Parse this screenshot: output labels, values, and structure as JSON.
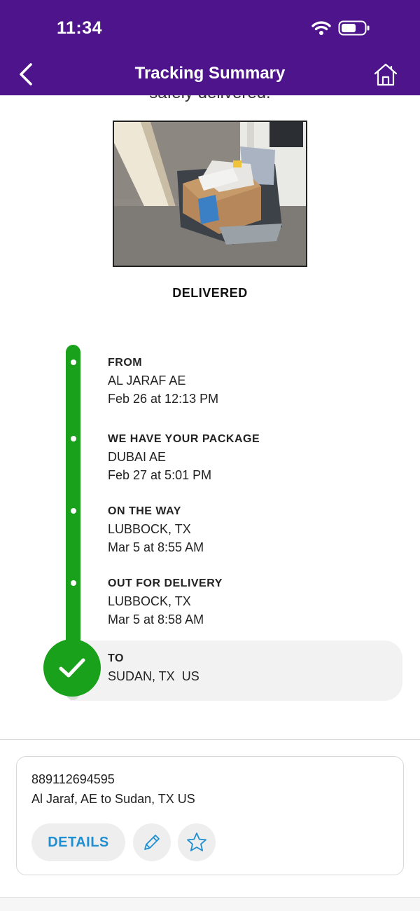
{
  "status_bar": {
    "time": "11:34"
  },
  "header": {
    "title": "Tracking Summary",
    "back_icon": "chevron-left-icon",
    "home_icon": "home-icon"
  },
  "delivery": {
    "partial_message": "safely delivered.",
    "photo_alt": "Delivered package photo",
    "status": "DELIVERED"
  },
  "timeline": {
    "events": [
      {
        "title": "FROM",
        "location": "AL JARAF AE",
        "time": "Feb 26 at 12:13 PM"
      },
      {
        "title": "WE HAVE YOUR PACKAGE",
        "location": "DUBAI AE",
        "time": "Feb 27 at 5:01 PM"
      },
      {
        "title": "ON THE WAY",
        "location": "LUBBOCK, TX",
        "time": "Mar 5 at 8:55 AM"
      },
      {
        "title": "OUT FOR DELIVERY",
        "location": "LUBBOCK, TX",
        "time": "Mar 5 at 8:58 AM"
      }
    ],
    "final": {
      "title": "TO",
      "location": "SUDAN, TX  US"
    }
  },
  "shipment_card": {
    "tracking_number": "889112694595",
    "route": "Al Jaraf, AE to Sudan, TX US",
    "details_label": "DETAILS"
  },
  "colors": {
    "header": "#4d148c",
    "timeline": "#1aa11b",
    "link": "#1f8fd1"
  }
}
